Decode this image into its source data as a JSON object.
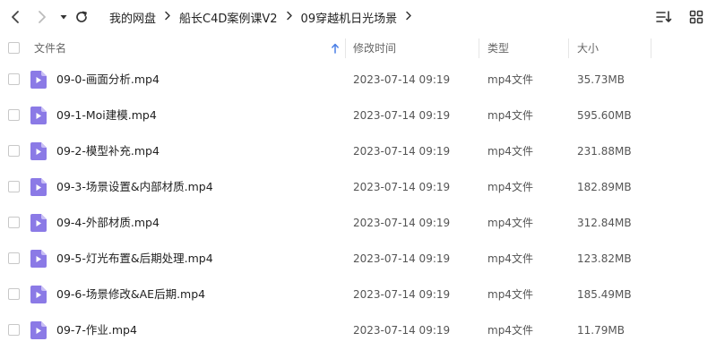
{
  "toolbar": {
    "back_icon": "chevron-left-icon",
    "forward_icon": "chevron-right-icon",
    "dropdown_icon": "caret-down-icon",
    "refresh_icon": "refresh-icon",
    "sort_icon": "sort-list-icon",
    "grid_icon": "grid-view-icon"
  },
  "breadcrumb": {
    "items": [
      {
        "label": "我的网盘"
      },
      {
        "label": "船长C4D案例课V2"
      },
      {
        "label": "09穿越机日光场景"
      }
    ]
  },
  "header": {
    "name": "文件名",
    "modified": "修改时间",
    "type": "类型",
    "size": "大小"
  },
  "colors": {
    "file_icon": "#8b7ae6",
    "file_icon_fold": "#c9bff5"
  },
  "files": [
    {
      "name": "09-0-画面分析.mp4",
      "modified": "2023-07-14 09:19",
      "type": "mp4文件",
      "size": "35.73MB"
    },
    {
      "name": "09-1-Moi建模.mp4",
      "modified": "2023-07-14 09:19",
      "type": "mp4文件",
      "size": "595.60MB"
    },
    {
      "name": "09-2-模型补充.mp4",
      "modified": "2023-07-14 09:19",
      "type": "mp4文件",
      "size": "231.88MB"
    },
    {
      "name": "09-3-场景设置&内部材质.mp4",
      "modified": "2023-07-14 09:19",
      "type": "mp4文件",
      "size": "182.89MB"
    },
    {
      "name": "09-4-外部材质.mp4",
      "modified": "2023-07-14 09:19",
      "type": "mp4文件",
      "size": "312.84MB"
    },
    {
      "name": "09-5-灯光布置&后期处理.mp4",
      "modified": "2023-07-14 09:19",
      "type": "mp4文件",
      "size": "123.82MB"
    },
    {
      "name": "09-6-场景修改&AE后期.mp4",
      "modified": "2023-07-14 09:19",
      "type": "mp4文件",
      "size": "185.49MB"
    },
    {
      "name": "09-7-作业.mp4",
      "modified": "2023-07-14 09:19",
      "type": "mp4文件",
      "size": "11.79MB"
    }
  ]
}
